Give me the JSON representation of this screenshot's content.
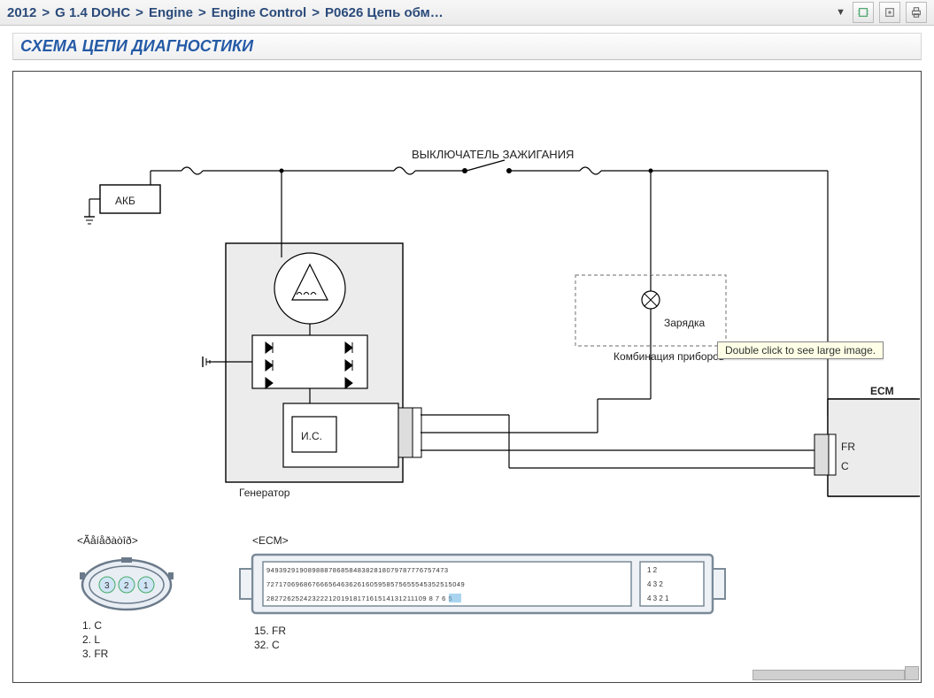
{
  "breadcrumb": {
    "c1": "2012",
    "c2": "G 1.4 DOHC",
    "c3": "Engine",
    "c4": "Engine Control",
    "c5": "P0626 Цепь обм…",
    "sep": ">"
  },
  "section_title": "СХЕМА ЦЕПИ ДИАГНОСТИКИ",
  "tooltip": "Double click to see large image.",
  "diagram": {
    "ignition_switch": "ВЫКЛЮЧАТЕЛЬ ЗАЖИГАНИЯ",
    "battery": "АКБ",
    "ic": "И.С.",
    "generator": "Генератор",
    "charging": "Зарядка",
    "instrument_cluster": "Комбинация приборов",
    "ecm": "ECM",
    "fr": "FR",
    "c": "C",
    "conn_generator_header": "<Ãåíåðàòîð>",
    "conn_ecm_header": "<ECM>",
    "pin_1c": "1. C",
    "pin_2l": "2. L",
    "pin_3fr": "3. FR",
    "ecm_pin_15": "15. FR",
    "ecm_pin_32": "32. C",
    "ecm_row_top": "94939291908988878685848382818079787776757473",
    "ecm_row_mid": "727170696867666564636261605958575655545352515049",
    "ecm_row_bot": "282726252423222120191817161514131211109 8 7 6 5",
    "ecm_small_top": "1 2",
    "ecm_small_mid": "4 3 2",
    "ecm_small_bot": "4 3 2 1",
    "conn_pins": [
      "3",
      "2",
      "1"
    ]
  }
}
